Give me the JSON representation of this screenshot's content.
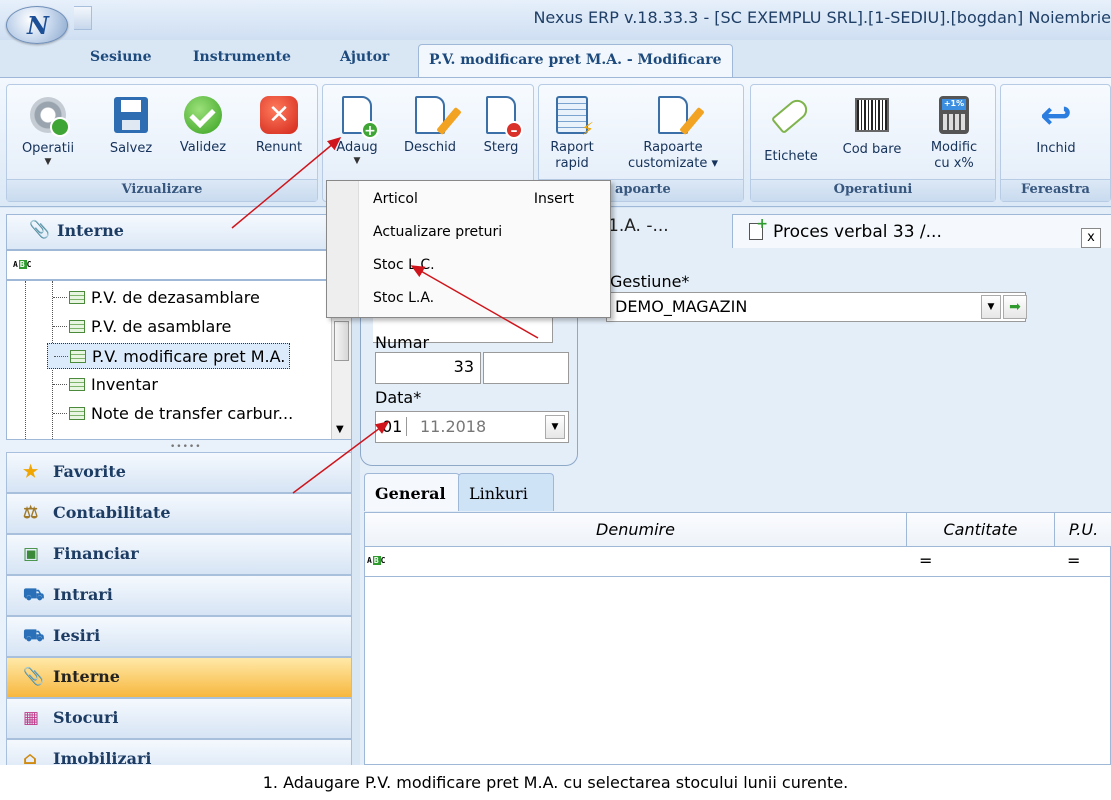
{
  "window": {
    "title": "Nexus ERP v.18.33.3 - [SC EXEMPLU SRL].[1-SEDIU].[bogdan] Noiembrie",
    "app_orb": "N"
  },
  "tabs": [
    "Sesiune",
    "Instrumente",
    "Ajutor",
    "P.V. modificare pret M.A. - Modificare"
  ],
  "ribbon": {
    "groups": {
      "vizualizare": "Vizualizare",
      "rapoarte": "apoarte",
      "operatiuni": "Operatiuni",
      "fereastra": "Fereastra"
    },
    "buttons": {
      "operatii": "Operatii",
      "salvez": "Salvez",
      "validez": "Validez",
      "renunt": "Renunt",
      "adaug": "Adaug",
      "deschid": "Deschid",
      "sterg": "Sterg",
      "raport_rapid_1": "Raport",
      "raport_rapid_2": "rapid",
      "rapoarte_custom_1": "Rapoarte",
      "rapoarte_custom_2": "customizate",
      "etichete": "Etichete",
      "cod_bare": "Cod bare",
      "modific_1": "Modific",
      "modific_2": "cu x%",
      "inchid": "Inchid"
    }
  },
  "dropdown_menu": {
    "items": [
      {
        "label": "Articol",
        "shortcut": "Insert"
      },
      {
        "label": "Actualizare preturi",
        "shortcut": ""
      },
      {
        "label": "Stoc L.C.",
        "shortcut": ""
      },
      {
        "label": "Stoc L.A.",
        "shortcut": ""
      }
    ]
  },
  "left_pane": {
    "header": "Interne",
    "filter_icon": "abc-filter-icon",
    "tree_items": [
      "P.V. de dezasamblare",
      "P.V. de asamblare",
      "P.V. modificare pret M.A.",
      "Inventar",
      "Note de transfer carbur..."
    ],
    "selected_index": 2,
    "nav": [
      "Favorite",
      "Contabilitate",
      "Financiar",
      "Intrari",
      "Iesiri",
      "Interne",
      "Stocuri",
      "Imobilizari"
    ],
    "active_nav": "Interne"
  },
  "document": {
    "prev_tab": "1.A. -...",
    "tab_title": "Proces verbal 33 /...",
    "close": "x",
    "gestiune_label": "Gestiune*",
    "gestiune_value": "DEMO_MAGAZIN",
    "numar_label": "Numar",
    "numar_value": "33",
    "data_label": "Data*",
    "data_day": "01",
    "data_rest": "11.2018",
    "subtabs": [
      "General",
      "Linkuri"
    ],
    "grid": {
      "columns": [
        "Denumire",
        "Cantitate",
        "P.U."
      ],
      "filter_ops": [
        "=",
        "="
      ]
    }
  },
  "caption": "1. Adaugare P.V. modificare pret M.A. cu selectarea stocului lunii curente.",
  "colors": {
    "accent": "#f7b73e",
    "arrow": "#d0141b",
    "ribbon_text": "#1d4a7c"
  }
}
